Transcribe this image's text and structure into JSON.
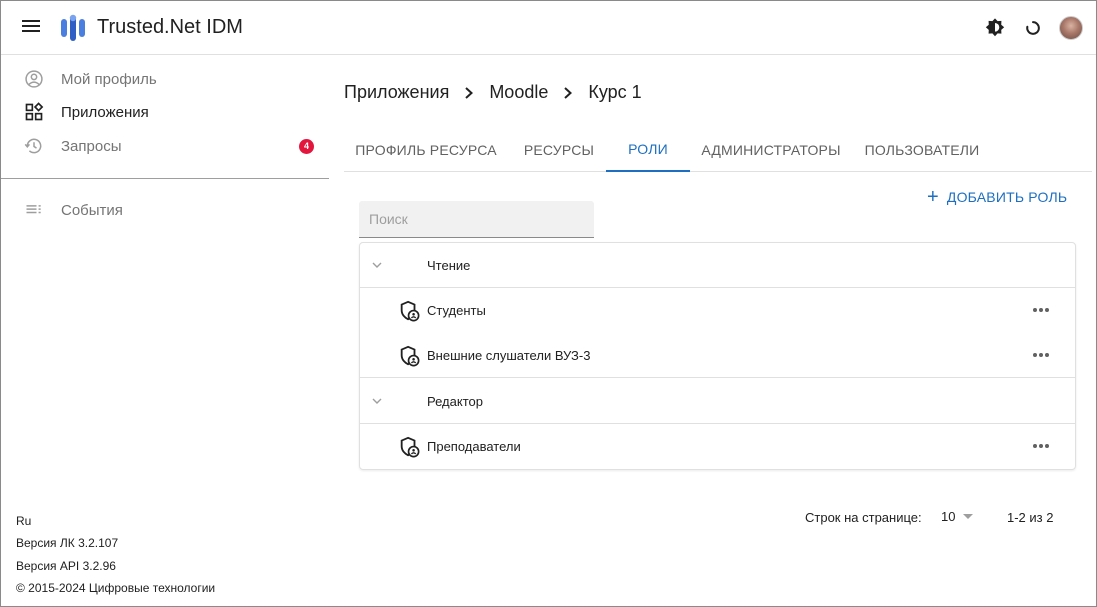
{
  "app": {
    "title": "Trusted.Net IDM"
  },
  "appbar_icons": [
    {
      "name": "theme-toggle-icon"
    },
    {
      "name": "refresh-icon"
    },
    {
      "name": "user-avatar"
    }
  ],
  "sidebar": {
    "items": [
      {
        "label": "Мой профиль",
        "icon": "account-circle-icon",
        "state": "inactive"
      },
      {
        "label": "Приложения",
        "icon": "apps-icon",
        "state": "active"
      },
      {
        "label": "Запросы",
        "icon": "history-icon",
        "state": "inactive",
        "badge": "4"
      },
      {
        "label": "События",
        "icon": "list-icon",
        "state": "inactive"
      }
    ],
    "footer": {
      "language": "Ru",
      "version_lk": "Версия ЛК 3.2.107",
      "version_api": "Версия API 3.2.96",
      "copyright": "© 2015-2024 Цифровые технологии"
    }
  },
  "breadcrumb": [
    "Приложения",
    "Moodle",
    "Курс 1"
  ],
  "tabs": [
    {
      "label": "ПРОФИЛЬ РЕСУРСА",
      "active": false
    },
    {
      "label": "РЕСУРСЫ",
      "active": false
    },
    {
      "label": "РОЛИ",
      "active": true
    },
    {
      "label": "АДМИНИСТРАТОРЫ",
      "active": false
    },
    {
      "label": "ПОЛЬЗОВАТЕЛИ",
      "active": false
    }
  ],
  "add_role_label": "ДОБАВИТЬ РОЛЬ",
  "search": {
    "placeholder": "Поиск",
    "value": ""
  },
  "roles_table": {
    "groups": [
      {
        "label": "Чтение",
        "roles": [
          "Студенты",
          "Внешние слушатели ВУЗ-3"
        ]
      },
      {
        "label": "Редактор",
        "roles": [
          "Преподаватели"
        ]
      }
    ]
  },
  "pagination": {
    "rows_per_page_label": "Строк на странице:",
    "rows_per_page_value": "10",
    "range": "1-2 из 2"
  },
  "colors": {
    "accent": "#1e6fc1",
    "badge": "#e3173e",
    "logo": "#3b6fd6"
  }
}
